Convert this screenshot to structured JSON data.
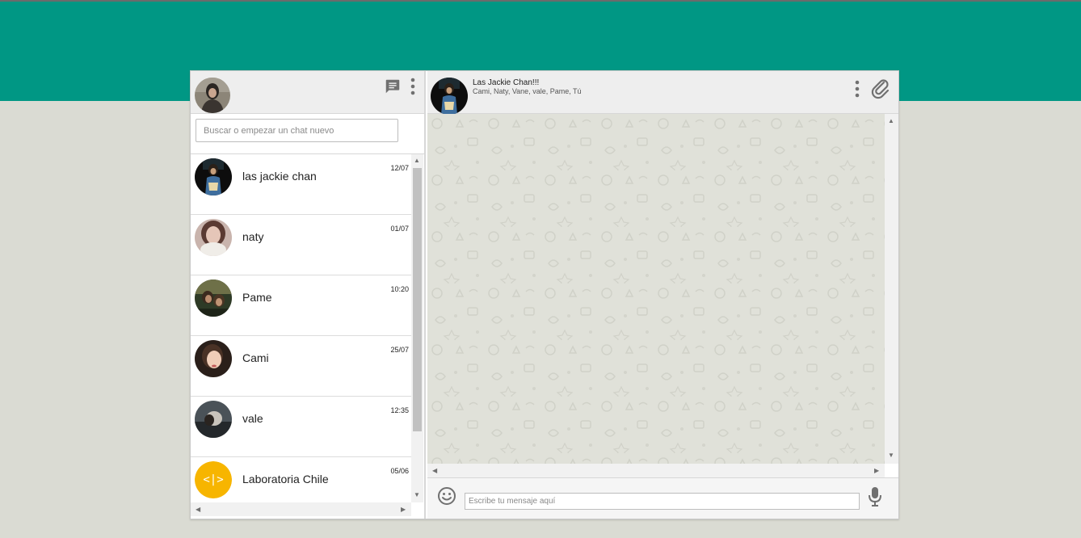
{
  "colors": {
    "brand": "#009784",
    "background": "#dadbd3",
    "panel_header": "#eeeeee",
    "chat_bg": "#e0e1d9"
  },
  "sidebar": {
    "header": {
      "icons": [
        "chat-icon",
        "menu-icon"
      ]
    },
    "search": {
      "placeholder": "Buscar o empezar un chat nuevo"
    },
    "chats": [
      {
        "name": "las jackie chan",
        "time": "12/07",
        "avatar": "group-photo"
      },
      {
        "name": "naty",
        "time": "01/07",
        "avatar": "profile-photo"
      },
      {
        "name": "Pame",
        "time": "10:20",
        "avatar": "profile-photo"
      },
      {
        "name": "Cami",
        "time": "25/07",
        "avatar": "profile-photo"
      },
      {
        "name": "vale",
        "time": "12:35",
        "avatar": "profile-photo"
      },
      {
        "name": "Laboratoria Chile",
        "time": "05/06",
        "avatar": "laboratoria-logo"
      }
    ]
  },
  "conversation": {
    "title": "Las Jackie Chan!!!",
    "members": "Cami, Naty, Vane, vale, Pame, Tú",
    "header_icons": [
      "menu-icon",
      "paperclip-icon"
    ],
    "composer": {
      "placeholder": "Escribe tu mensaje aquí",
      "icons": [
        "emoji-icon",
        "microphone-icon"
      ]
    }
  }
}
